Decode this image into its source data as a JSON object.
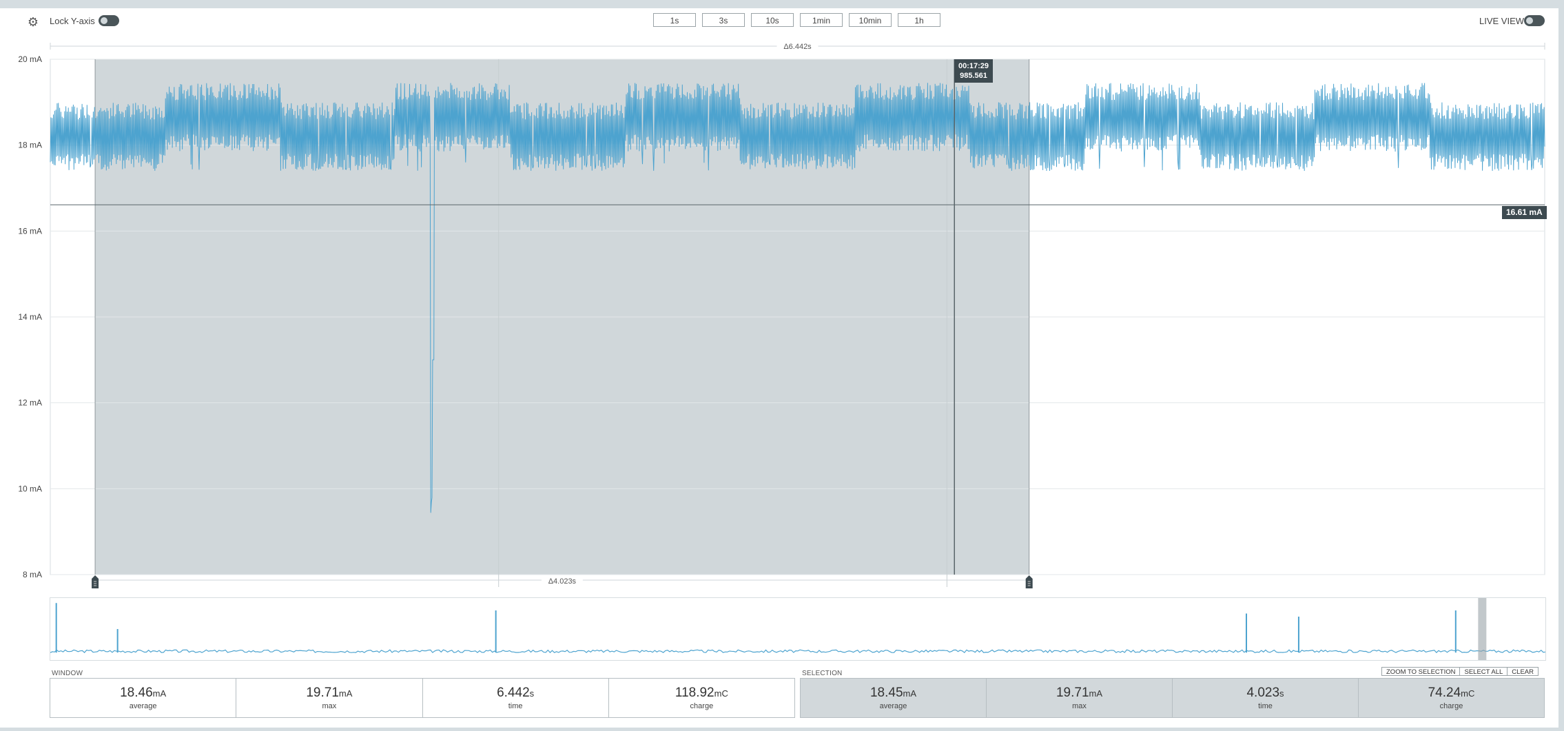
{
  "toolbar": {
    "lock_y_axis_label": "Lock Y-axis",
    "lock_y_axis_on": false,
    "window_buttons": [
      "1s",
      "3s",
      "10s",
      "1min",
      "10min",
      "1h"
    ],
    "live_view_label": "LIVE VIEW",
    "live_view_on": false
  },
  "chart_data": {
    "type": "line",
    "ylabel": "",
    "ylim": [
      8,
      20
    ],
    "y_ticks": [
      "20 mA",
      "18 mA",
      "16 mA",
      "14 mA",
      "12 mA",
      "10 mA",
      "8 mA"
    ],
    "y_tick_values": [
      20,
      18,
      16,
      14,
      12,
      10,
      8
    ],
    "series": [
      {
        "color": "#4da3cf",
        "approx_mean": 18.2,
        "approx_range": [
          17.4,
          19.1
        ],
        "dip": {
          "min": 9.2,
          "fraction_of_window": 0.255
        }
      }
    ],
    "window_delta_label": "Δ6.442s",
    "selection_delta_label": "Δ4.023s",
    "selection": {
      "start_fraction": 0.03,
      "end_fraction": 0.655
    },
    "cursor": {
      "fraction": 0.605,
      "time": "00:17:29",
      "sub": "985.561"
    },
    "hline": {
      "value": 16.61,
      "label": "16.61 mA"
    },
    "grid": true
  },
  "overview": {
    "color": "#4da3cf",
    "baseline_fraction": 0.12,
    "spikes": [
      {
        "at": 0.004,
        "height": 0.92
      },
      {
        "at": 0.045,
        "height": 0.5
      },
      {
        "at": 0.298,
        "height": 0.8
      },
      {
        "at": 0.8,
        "height": 0.75
      },
      {
        "at": 0.835,
        "height": 0.7
      },
      {
        "at": 0.94,
        "height": 0.8
      }
    ],
    "viewport": {
      "start_fraction": 0.955,
      "end_fraction": 0.96
    }
  },
  "window": {
    "label": "WINDOW",
    "stats": [
      {
        "value": "18.46",
        "unit": "mA",
        "name": "average"
      },
      {
        "value": "19.71",
        "unit": "mA",
        "name": "max"
      },
      {
        "value": "6.442",
        "unit": "s",
        "name": "time"
      },
      {
        "value": "118.92",
        "unit": "mC",
        "name": "charge"
      }
    ]
  },
  "selection": {
    "label": "SELECTION",
    "actions": [
      "ZOOM TO SELECTION",
      "SELECT ALL",
      "CLEAR"
    ],
    "stats": [
      {
        "value": "18.45",
        "unit": "mA",
        "name": "average"
      },
      {
        "value": "19.71",
        "unit": "mA",
        "name": "max"
      },
      {
        "value": "4.023",
        "unit": "s",
        "name": "time"
      },
      {
        "value": "74.24",
        "unit": "mC",
        "name": "charge"
      }
    ]
  }
}
